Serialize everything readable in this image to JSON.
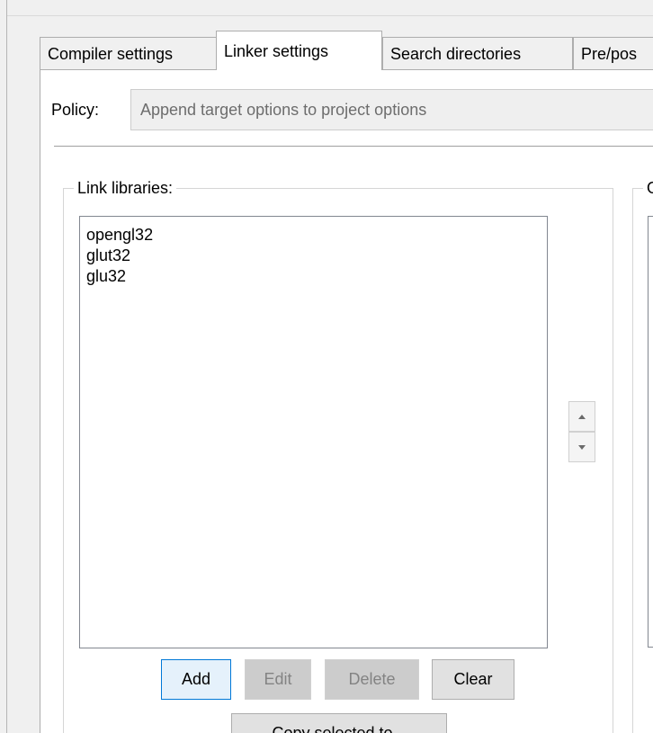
{
  "tabs": [
    {
      "label": "Compiler settings",
      "active": false
    },
    {
      "label": "Linker settings",
      "active": true
    },
    {
      "label": "Search directories",
      "active": false
    },
    {
      "label": "Pre/pos",
      "active": false
    }
  ],
  "policy": {
    "label": "Policy:",
    "value": "Append target options to project options"
  },
  "link_libraries": {
    "title": "Link libraries:",
    "items": [
      "opengl32",
      "glut32",
      "glu32"
    ]
  },
  "other_group": {
    "title": "O"
  },
  "buttons": {
    "add": "Add",
    "edit": "Edit",
    "delete": "Delete",
    "clear": "Clear",
    "copy_selected": "Copy selected to..."
  },
  "icons": {
    "spin_up": "triangle-up-icon",
    "spin_down": "triangle-down-icon"
  },
  "colors": {
    "background": "#f0f0f0",
    "panel": "#ffffff",
    "focus_border": "#0078d7",
    "disabled_text": "#838383"
  }
}
